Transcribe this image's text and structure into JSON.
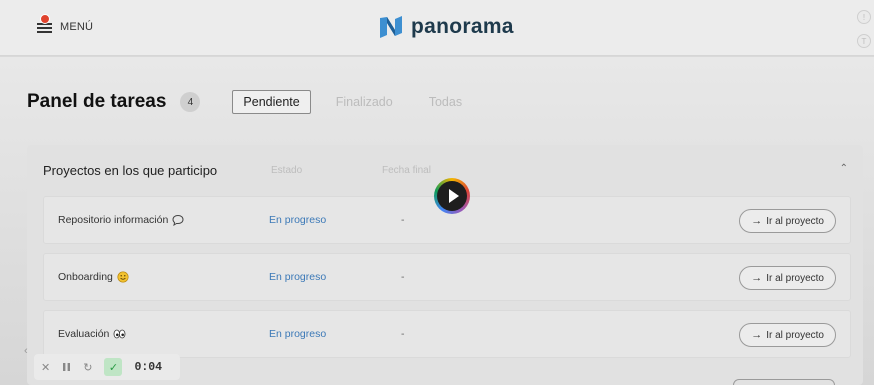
{
  "header": {
    "menu_label": "MENÚ",
    "logo_text": "panorama",
    "side_badges": [
      "!",
      "T"
    ]
  },
  "panel": {
    "title": "Panel de tareas",
    "count": "4",
    "tabs": [
      {
        "label": "Pendiente",
        "active": true
      },
      {
        "label": "Finalizado",
        "active": false
      },
      {
        "label": "Todas",
        "active": false
      }
    ]
  },
  "section": {
    "title": "Proyectos en los que participo",
    "col_estado": "Estado",
    "col_fecha": "Fecha final",
    "collapse_icon": "chevron-up-icon"
  },
  "rows": [
    {
      "name": "Repositorio información",
      "icon": "speech-bubble-icon",
      "status": "En progreso",
      "date": "-",
      "action": "Ir al proyecto"
    },
    {
      "name": "Onboarding",
      "icon": "smiley-icon",
      "status": "En progreso",
      "date": "-",
      "action": "Ir al proyecto"
    },
    {
      "name": "Evaluación",
      "icon": "eyes-icon",
      "status": "En progreso",
      "date": "-",
      "action": "Ir al proyecto"
    }
  ],
  "video_controls": {
    "time": "0:04"
  },
  "colors": {
    "accent": "#3c79b7",
    "logo": "#1e3a4c",
    "notification": "#e0432d"
  }
}
